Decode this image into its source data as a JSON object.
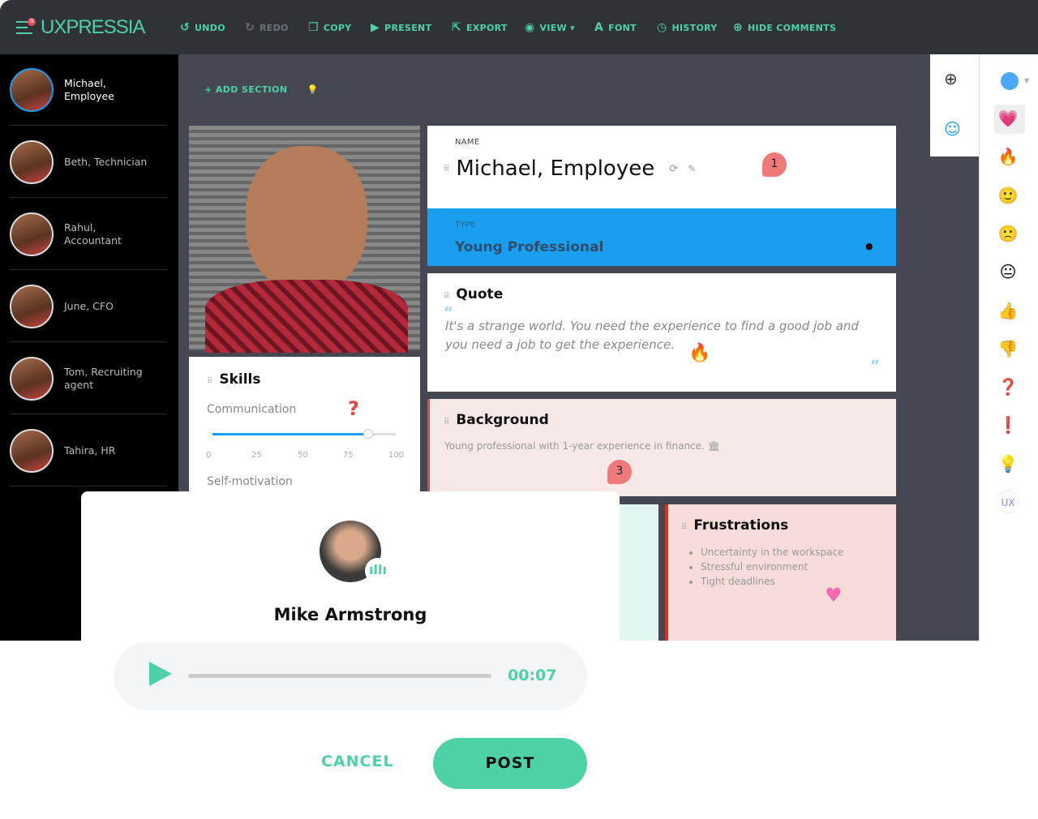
{
  "app": {
    "logo": "UXPRESSIA",
    "notif_count": "51"
  },
  "toolbar": [
    {
      "label": "UNDO",
      "icon": "undo-icon",
      "glyph": "↺",
      "enabled": true
    },
    {
      "label": "REDO",
      "icon": "redo-icon",
      "glyph": "↻",
      "enabled": false
    },
    {
      "label": "COPY",
      "icon": "copy-icon",
      "glyph": "❐",
      "enabled": true
    },
    {
      "label": "PRESENT",
      "icon": "present-icon",
      "glyph": "▶",
      "enabled": true
    },
    {
      "label": "EXPORT",
      "icon": "export-icon",
      "glyph": "⇱",
      "enabled": true
    },
    {
      "label": "VIEW ▾",
      "icon": "eye-icon",
      "glyph": "◉",
      "enabled": true
    },
    {
      "label": "FONT",
      "icon": "font-icon",
      "glyph": "A",
      "enabled": true
    },
    {
      "label": "HISTORY",
      "icon": "history-icon",
      "glyph": "◷",
      "enabled": true
    },
    {
      "label": "HIDE COMMENTS",
      "icon": "comment-icon",
      "glyph": "⊕",
      "enabled": true
    }
  ],
  "personas": [
    {
      "name": "Michael, Employee",
      "active": true
    },
    {
      "name": "Beth, Technician"
    },
    {
      "name": "Rahul, Accountant"
    },
    {
      "name": "June, CFO"
    },
    {
      "name": "Tom, Recruiting agent"
    },
    {
      "name": "Tahira, HR"
    }
  ],
  "canvas": {
    "add_section": "+ ADD SECTION",
    "name_label": "NAME",
    "name_value": "Michael, Employee",
    "comment_1": "1",
    "type_label": "TYPE",
    "type_value": "Young Professional",
    "type_color": "#1a9ff0",
    "quote_title": "Quote",
    "quote_text": "It's a strange world. You need the experience to find a good job and you need a job to get the experience.",
    "skills_title": "Skills",
    "skill_1": "Communication",
    "skill_1_value": 85,
    "skill_2": "Self-motivation",
    "ticks": [
      "0",
      "25",
      "50",
      "75",
      "100"
    ],
    "background_title": "Background",
    "background_text": "Young professional with 1-year experience in finance.",
    "comment_3": "3",
    "frustrations_title": "Frustrations",
    "frustrations": [
      "Uncertainty in the workspace",
      "Stressful environment",
      "Tight deadlines"
    ]
  },
  "reactions": [
    "heart",
    "fire",
    "smile",
    "sad",
    "neutral",
    "thumbs-up",
    "thumbs-down",
    "question",
    "exclamation",
    "lightbulb",
    "UX"
  ],
  "modal": {
    "name": "Mike Armstrong",
    "time": "00:07",
    "progress": 0,
    "cancel": "CANCEL",
    "post": "POST",
    "accent": "#4fd1a7"
  }
}
